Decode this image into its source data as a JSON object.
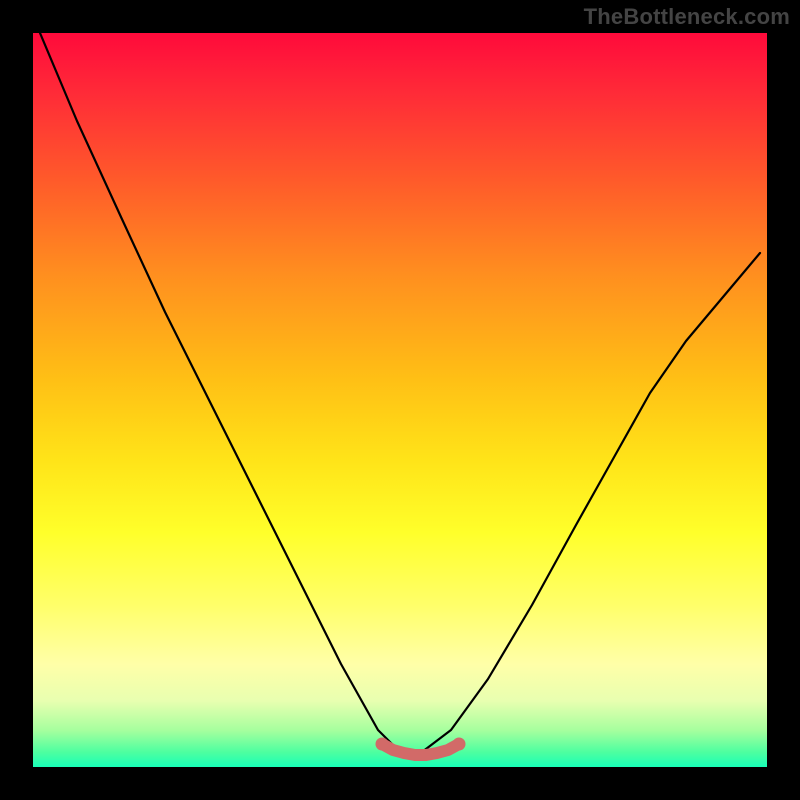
{
  "watermark": "TheBottleneck.com",
  "chart_data": {
    "type": "line",
    "title": "",
    "xlabel": "",
    "ylabel": "",
    "xlim": [
      0,
      1
    ],
    "ylim": [
      0,
      1
    ],
    "series": [
      {
        "name": "curve",
        "x": [
          0.01,
          0.06,
          0.12,
          0.18,
          0.24,
          0.3,
          0.36,
          0.42,
          0.47,
          0.5,
          0.53,
          0.57,
          0.62,
          0.68,
          0.74,
          0.79,
          0.84,
          0.89,
          0.94,
          0.99
        ],
        "values": [
          1.0,
          0.88,
          0.75,
          0.62,
          0.5,
          0.38,
          0.26,
          0.14,
          0.05,
          0.02,
          0.02,
          0.05,
          0.12,
          0.22,
          0.33,
          0.42,
          0.51,
          0.58,
          0.64,
          0.7
        ]
      },
      {
        "name": "bottom-marker",
        "color": "#d26a68",
        "x": [
          0.475,
          0.49,
          0.505,
          0.52,
          0.535,
          0.55,
          0.565,
          0.58
        ],
        "values": [
          0.032,
          0.024,
          0.02,
          0.018,
          0.018,
          0.02,
          0.024,
          0.032
        ]
      }
    ],
    "gradient_stops": [
      {
        "pos": 0.0,
        "color": "#ff0a3b"
      },
      {
        "pos": 0.08,
        "color": "#ff2a38"
      },
      {
        "pos": 0.2,
        "color": "#ff5a2a"
      },
      {
        "pos": 0.33,
        "color": "#ff8f1f"
      },
      {
        "pos": 0.47,
        "color": "#ffbf15"
      },
      {
        "pos": 0.58,
        "color": "#ffe318"
      },
      {
        "pos": 0.68,
        "color": "#ffff2a"
      },
      {
        "pos": 0.78,
        "color": "#ffff6a"
      },
      {
        "pos": 0.86,
        "color": "#ffffa8"
      },
      {
        "pos": 0.91,
        "color": "#e8ffb0"
      },
      {
        "pos": 0.95,
        "color": "#a6ff9e"
      },
      {
        "pos": 0.98,
        "color": "#4dffa0"
      },
      {
        "pos": 1.0,
        "color": "#18ffb8"
      }
    ]
  }
}
